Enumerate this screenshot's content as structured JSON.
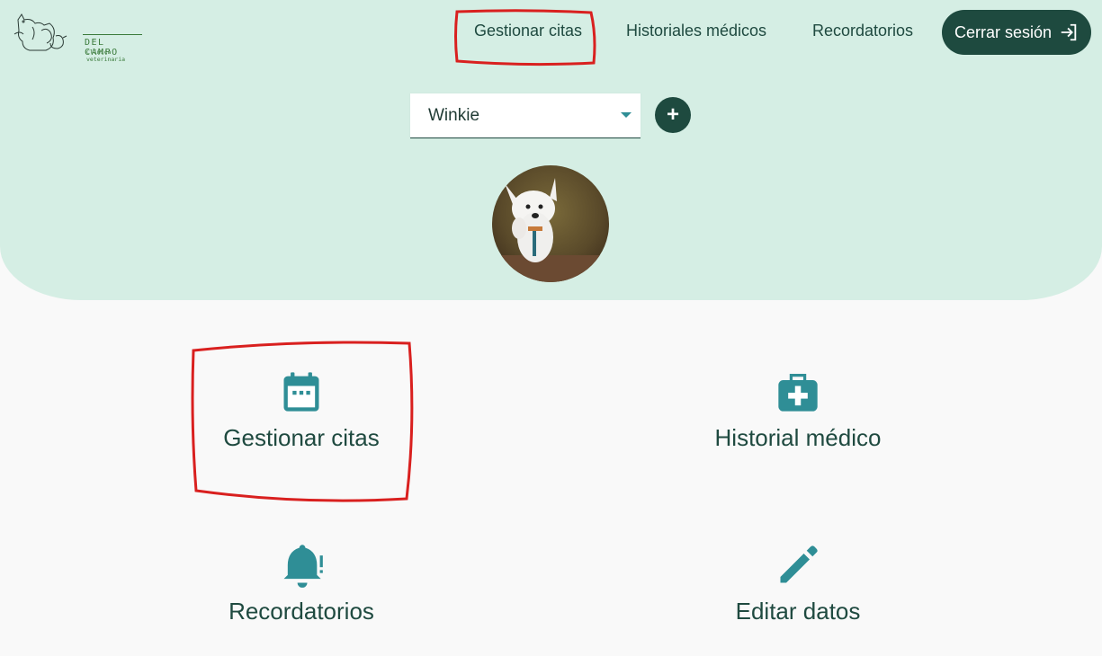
{
  "brand": {
    "name": "DEL CAMPO",
    "subtitle": "Clínica veterinaria"
  },
  "nav": {
    "items": [
      {
        "label": "Gestionar citas"
      },
      {
        "label": "Historiales médicos"
      },
      {
        "label": "Recordatorios"
      }
    ],
    "logout_label": "Cerrar sesión"
  },
  "pet_selector": {
    "selected": "Winkie"
  },
  "add_button": {
    "label": "+"
  },
  "cards": [
    {
      "label": "Gestionar citas",
      "icon": "calendar-icon"
    },
    {
      "label": "Historial médico",
      "icon": "medical-kit-icon"
    },
    {
      "label": "Recordatorios",
      "icon": "bell-alert-icon"
    },
    {
      "label": "Editar datos",
      "icon": "pencil-icon"
    }
  ],
  "colors": {
    "header_bg": "#d5eee4",
    "primary_dark": "#1e4a3f",
    "icon_teal": "#2f8e96",
    "annotation_red": "#d9201f"
  }
}
